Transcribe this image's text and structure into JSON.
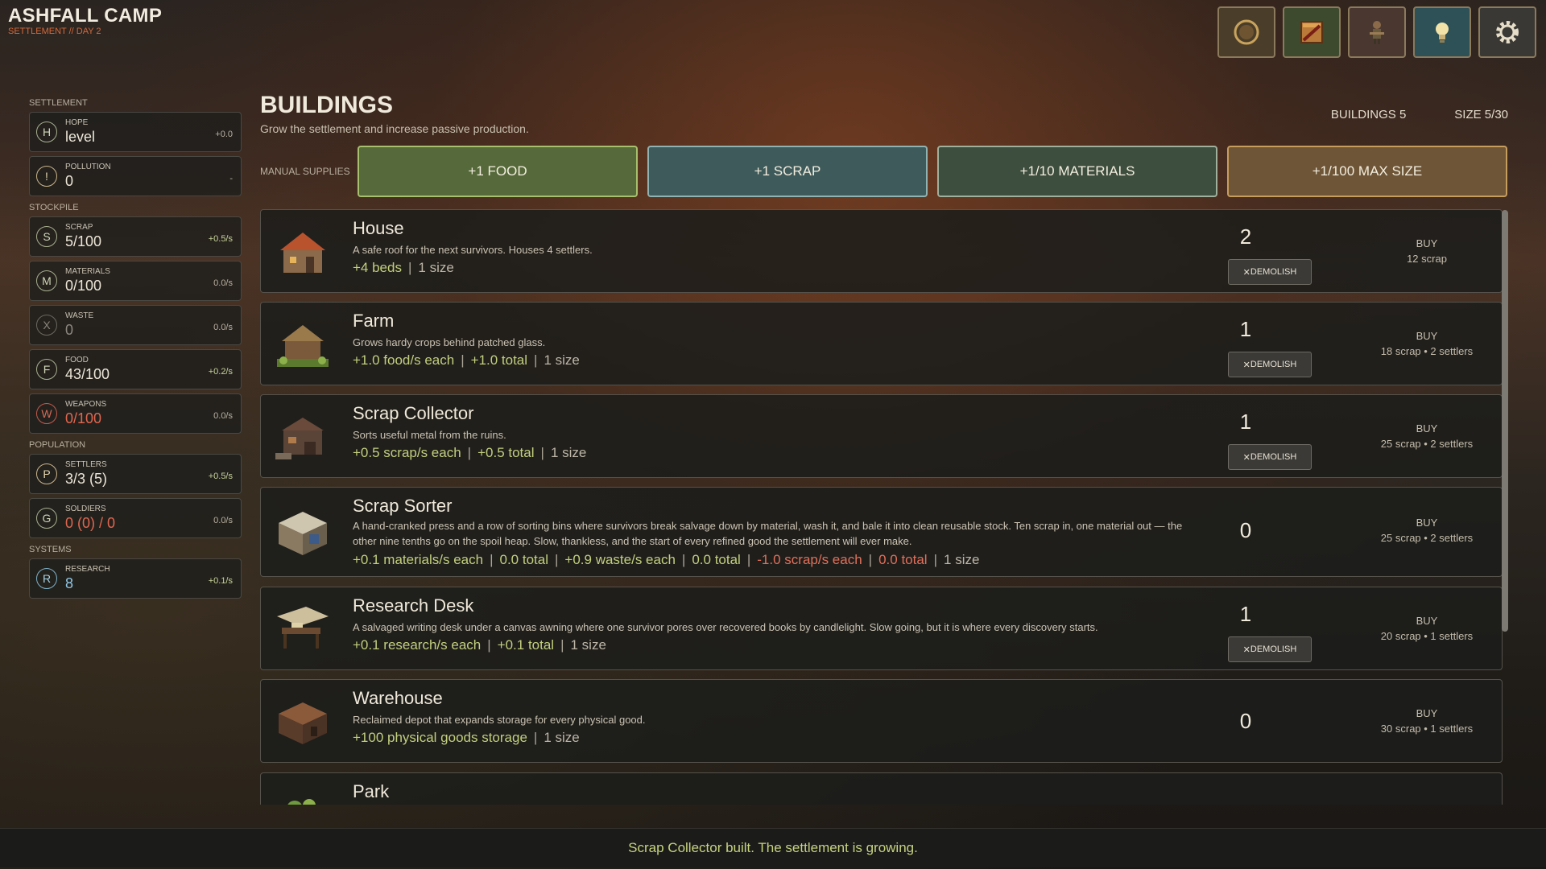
{
  "app": {
    "title": "ASHFALL CAMP",
    "subtitle": "SETTLEMENT // DAY 2"
  },
  "topbar": {
    "icons": [
      {
        "name": "compass-icon",
        "bg": "#4a3e2a"
      },
      {
        "name": "crate-icon",
        "bg": "#3d4a2e"
      },
      {
        "name": "soldier-icon",
        "bg": "#4a3830"
      },
      {
        "name": "lightbulb-icon",
        "bg": "#2e5157"
      },
      {
        "name": "gear-icon",
        "bg": "#3a3834"
      }
    ]
  },
  "sidebar": {
    "settlement_label": "SETTLEMENT",
    "stockpile_label": "STOCKPILE",
    "population_label": "POPULATION",
    "systems_label": "SYSTEMS",
    "hope": {
      "badge": "H",
      "label": "HOPE",
      "value": "level",
      "rate": "+0.0"
    },
    "pollution": {
      "badge": "!",
      "label": "POLLUTION",
      "value": "0",
      "rate": "-"
    },
    "scrap": {
      "badge": "S",
      "label": "SCRAP",
      "value": "5/100",
      "rate": "+0.5/s"
    },
    "materials": {
      "badge": "M",
      "label": "MATERIALS",
      "value": "0/100",
      "rate": "0.0/s"
    },
    "waste": {
      "badge": "X",
      "label": "WASTE",
      "value": "0",
      "rate": "0.0/s"
    },
    "food": {
      "badge": "F",
      "label": "FOOD",
      "value": "43/100",
      "rate": "+0.2/s"
    },
    "weapons": {
      "badge": "W",
      "label": "WEAPONS",
      "value": "0/100",
      "rate": "0.0/s"
    },
    "settlers": {
      "badge": "P",
      "label": "SETTLERS",
      "value": "3/3 (5)",
      "rate": "+0.5/s"
    },
    "soldiers": {
      "badge": "G",
      "label": "SOLDIERS",
      "value": "0 (0) / 0",
      "rate": "0.0/s"
    },
    "research": {
      "badge": "R",
      "label": "RESEARCH",
      "value": "8",
      "rate": "+0.1/s"
    }
  },
  "main": {
    "title": "BUILDINGS",
    "description": "Grow the settlement and increase passive production.",
    "buildings_count": "BUILDINGS  5",
    "size": "SIZE  5/30"
  },
  "supplies": {
    "label": "MANUAL SUPPLIES",
    "food": "+1 FOOD",
    "scrap": "+1 SCRAP",
    "materials": "+1/10 MATERIALS",
    "max_size": "+1/100 MAX SIZE"
  },
  "buildings": [
    {
      "name": "House",
      "description": "A safe roof for the next survivors. Houses 4 settlers.",
      "stats": [
        {
          "text": "+4 beds",
          "kind": "pos"
        },
        {
          "text": "1 size",
          "kind": "plain"
        }
      ],
      "count": "2",
      "demolish": "DEMOLISH",
      "buy_label": "BUY",
      "cost": "12 scrap"
    },
    {
      "name": "Farm",
      "description": "Grows hardy crops behind patched glass.",
      "stats": [
        {
          "text": "+1.0 food/s each",
          "kind": "pos"
        },
        {
          "text": "+1.0 total",
          "kind": "pos"
        },
        {
          "text": "1 size",
          "kind": "plain"
        }
      ],
      "count": "1",
      "demolish": "DEMOLISH",
      "buy_label": "BUY",
      "cost": "18 scrap  •  2 settlers"
    },
    {
      "name": "Scrap Collector",
      "description": "Sorts useful metal from the ruins.",
      "stats": [
        {
          "text": "+0.5 scrap/s each",
          "kind": "pos"
        },
        {
          "text": "+0.5 total",
          "kind": "pos"
        },
        {
          "text": "1 size",
          "kind": "plain"
        }
      ],
      "count": "1",
      "demolish": "DEMOLISH",
      "buy_label": "BUY",
      "cost": "25 scrap  •  2 settlers"
    },
    {
      "name": "Scrap Sorter",
      "description": "A hand-cranked press and a row of sorting bins where survivors break salvage down by material, wash it, and bale it into clean reusable stock. Ten scrap in, one material out — the other nine tenths go on the spoil heap. Slow, thankless, and the start of every refined good the settlement will ever make.",
      "stats": [
        {
          "text": "+0.1 materials/s each",
          "kind": "pos"
        },
        {
          "text": "0.0 total",
          "kind": "pos"
        },
        {
          "text": "+0.9 waste/s each",
          "kind": "pos"
        },
        {
          "text": "0.0 total",
          "kind": "pos"
        },
        {
          "text": "-1.0 scrap/s each",
          "kind": "neg"
        },
        {
          "text": "0.0 total",
          "kind": "neg"
        },
        {
          "text": "1 size",
          "kind": "plain"
        }
      ],
      "count": "0",
      "demolish": "",
      "buy_label": "BUY",
      "cost": "25 scrap  •  2 settlers"
    },
    {
      "name": "Research Desk",
      "description": "A salvaged writing desk under a canvas awning where one survivor pores over recovered books by candlelight. Slow going, but it is where every discovery starts.",
      "stats": [
        {
          "text": "+0.1 research/s each",
          "kind": "pos"
        },
        {
          "text": "+0.1 total",
          "kind": "pos"
        },
        {
          "text": "1 size",
          "kind": "plain"
        }
      ],
      "count": "1",
      "demolish": "DEMOLISH",
      "buy_label": "BUY",
      "cost": "20 scrap  •  1 settlers"
    },
    {
      "name": "Warehouse",
      "description": "Reclaimed depot that expands storage for every physical good.",
      "stats": [
        {
          "text": "+100 physical goods storage",
          "kind": "pos"
        },
        {
          "text": "1 size",
          "kind": "plain"
        }
      ],
      "count": "0",
      "demolish": "",
      "buy_label": "BUY",
      "cost": "30 scrap  •  1 settlers"
    },
    {
      "name": "Park",
      "description": "",
      "stats": [],
      "count": "",
      "demolish": "",
      "buy_label": "",
      "cost": ""
    }
  ],
  "status_message": "Scrap Collector built. The settlement is growing."
}
